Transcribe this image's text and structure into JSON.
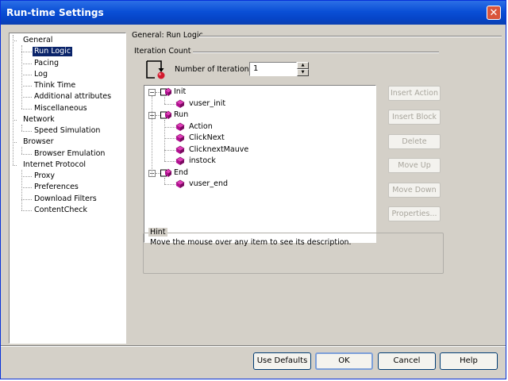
{
  "window": {
    "title": "Run-time Settings",
    "close_glyph": "✕"
  },
  "nav_tree": [
    {
      "label": "General",
      "level": 0
    },
    {
      "label": "Run Logic",
      "level": 1,
      "selected": true
    },
    {
      "label": "Pacing",
      "level": 1
    },
    {
      "label": "Log",
      "level": 1
    },
    {
      "label": "Think Time",
      "level": 1
    },
    {
      "label": "Additional attributes",
      "level": 1
    },
    {
      "label": "Miscellaneous",
      "level": 1
    },
    {
      "label": "Network",
      "level": 0
    },
    {
      "label": "Speed Simulation",
      "level": 1
    },
    {
      "label": "Browser",
      "level": 0
    },
    {
      "label": "Browser Emulation",
      "level": 1
    },
    {
      "label": "Internet Protocol",
      "level": 0
    },
    {
      "label": "Proxy",
      "level": 1
    },
    {
      "label": "Preferences",
      "level": 1
    },
    {
      "label": "Download Filters",
      "level": 1
    },
    {
      "label": "ContentCheck",
      "level": 1
    }
  ],
  "page": {
    "title": "General: Run Logic"
  },
  "iteration": {
    "group_label": "Iteration Count",
    "field_label": "Number of Iterations:",
    "value": "1",
    "icon": "iteration-icon"
  },
  "action_tree": [
    {
      "label": "Init",
      "kind": "section",
      "expanded": true
    },
    {
      "label": "vuser_init",
      "kind": "action"
    },
    {
      "label": "Run",
      "kind": "section",
      "expanded": true
    },
    {
      "label": "Action",
      "kind": "action"
    },
    {
      "label": "ClickNext",
      "kind": "action"
    },
    {
      "label": "ClicknextMauve",
      "kind": "action"
    },
    {
      "label": "instock",
      "kind": "action"
    },
    {
      "label": "End",
      "kind": "section",
      "expanded": true
    },
    {
      "label": "vuser_end",
      "kind": "action"
    }
  ],
  "side_buttons": [
    {
      "label": "Insert Action",
      "enabled": false
    },
    {
      "label": "Insert Block",
      "enabled": false
    },
    {
      "label": "Delete",
      "enabled": false
    },
    {
      "label": "Move Up",
      "enabled": false
    },
    {
      "label": "Move Down",
      "enabled": false
    },
    {
      "label": "Properties...",
      "enabled": false
    }
  ],
  "hint": {
    "title": "Hint",
    "text": "Move the mouse over any item to see its description."
  },
  "footer": {
    "use_defaults": "Use Defaults",
    "ok": "OK",
    "cancel": "Cancel",
    "help": "Help"
  },
  "colors": {
    "titlebar": "#0a4fd6",
    "selection": "#0a246a",
    "dialog_face": "#d4d0c8",
    "action_icon": "#c0189a",
    "disabled_text": "#a8a59c"
  }
}
